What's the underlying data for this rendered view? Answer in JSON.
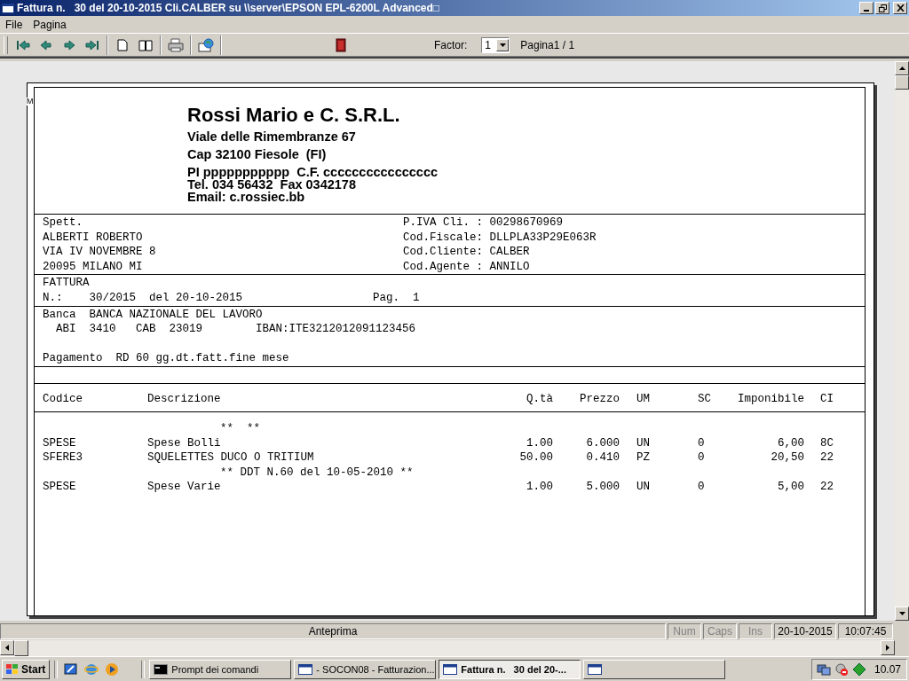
{
  "window": {
    "title": "Fattura n.   30 del 20-10-2015 Cli.CALBER su \\\\server\\EPSON EPL-6200L Advanced□"
  },
  "menu": [
    "File",
    "Pagina"
  ],
  "toolbar": {
    "factor_label": "Factor:",
    "factor_value": "1",
    "page_label": "Pagina1 / 1"
  },
  "document": {
    "margin_mark": "M",
    "company": {
      "name": "Rossi Mario e C. S.R.L.",
      "lines": [
        "Viale delle Rimembranze 67",
        "Cap 32100 Fiesole  (FI)"
      ],
      "tight_lines": [
        "PI ppppppppppp  C.F. cccccccccccccccc",
        "Tel. 034 56432  Fax 0342178",
        "Email: c.rossiec.bb"
      ]
    },
    "recipient": [
      "Spett.",
      "ALBERTI ROBERTO",
      "VIA IV NOVEMBRE 8",
      "20095 MILANO MI"
    ],
    "customer_info": [
      "P.IVA Cli. : 00298670969",
      "Cod.Fiscale: DLLPLA33P29E063R",
      "Cod.Cliente: CALBER",
      "Cod.Agente : ANNILO"
    ],
    "invoice": {
      "title": "FATTURA",
      "number": "N.:    30/2015  del 20-10-2015",
      "page": "Pag.  1"
    },
    "bank": {
      "line": "Banca  BANCA NAZIONALE DEL LAVORO",
      "codes": "  ABI  3410   CAB  23019        IBAN:ITE3212012091123456",
      "payment": "Pagamento  RD 60 gg.dt.fatt.fine mese"
    },
    "table": {
      "columns": [
        "Codice",
        "Descrizione",
        "Q.tà",
        "Prezzo",
        "UM",
        "SC",
        "Imponibile",
        "CI"
      ],
      "rows": [
        {
          "kind": "note",
          "text": "**  **"
        },
        {
          "kind": "item",
          "cells": [
            "SPESE",
            "Spese Bolli",
            "1.00",
            "6.000",
            "UN",
            "0",
            "6,00",
            "8C"
          ]
        },
        {
          "kind": "item",
          "cells": [
            "SFERE3",
            "SQUELETTES DUCO O TRITIUM",
            "50.00",
            "0.410",
            "PZ",
            "0",
            "20,50",
            "22"
          ]
        },
        {
          "kind": "note",
          "text": "** DDT N.60 del 10-05-2010 **"
        },
        {
          "kind": "item",
          "cells": [
            "SPESE",
            "Spese Varie",
            "1.00",
            "5.000",
            "UN",
            "0",
            "5,00",
            "22"
          ]
        }
      ]
    }
  },
  "status_bar": {
    "message": "Anteprima",
    "indicators": [
      {
        "label": "Num",
        "active": false
      },
      {
        "label": "Caps",
        "active": false
      },
      {
        "label": "Ins",
        "active": false
      }
    ],
    "date": "20-10-2015",
    "time": "10:07:45"
  },
  "taskbar": {
    "start": "Start",
    "tasks": [
      {
        "label": "Prompt dei comandi",
        "kind": "console",
        "selected": false
      },
      {
        "label": "- SOCON08 - Fatturazion...",
        "kind": "window",
        "selected": false
      },
      {
        "label": "Fattura n.   30 del 20-...",
        "kind": "window",
        "selected": true
      },
      {
        "kind": "window",
        "selected": false
      }
    ],
    "clock": "10.07"
  }
}
